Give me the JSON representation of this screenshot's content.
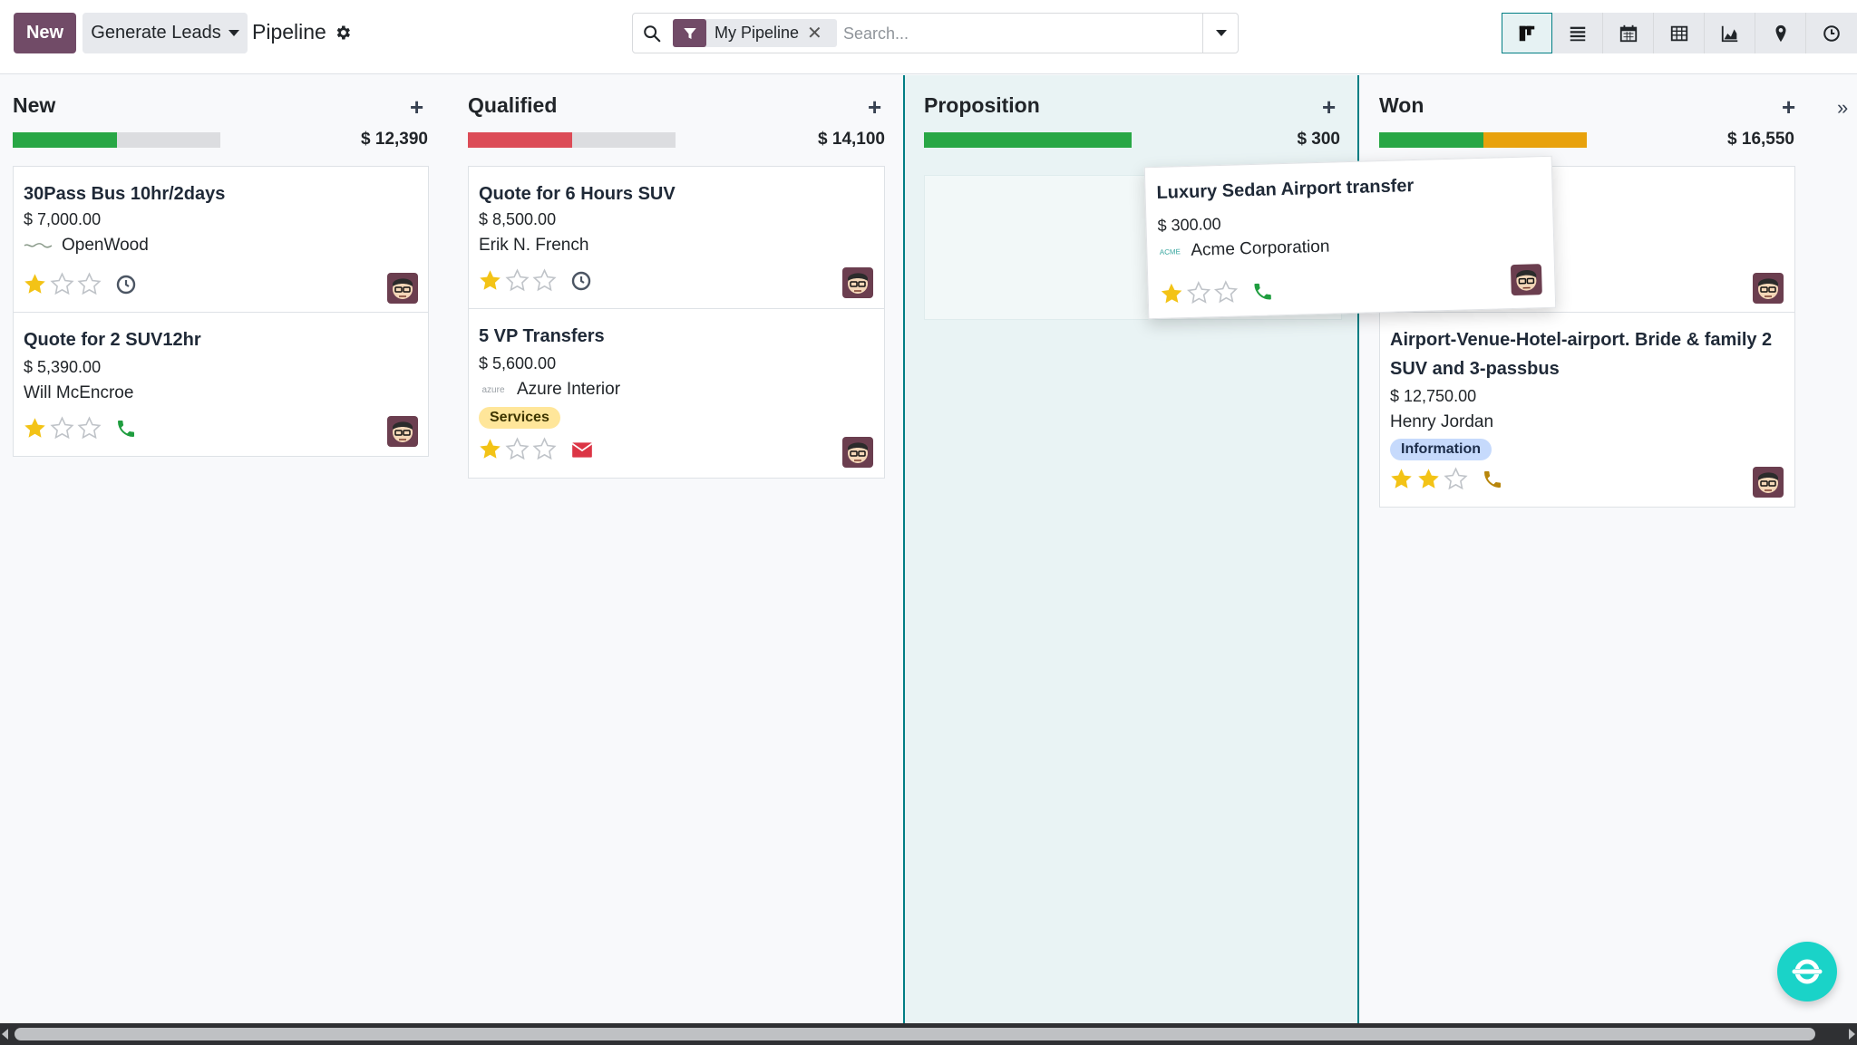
{
  "toolbar": {
    "new_label": "New",
    "generate_label": "Generate Leads",
    "title": "Pipeline",
    "search_facet": "My Pipeline",
    "search_placeholder": "Search...",
    "views": [
      "kanban-view-icon",
      "list-view-icon",
      "calendar-view-icon",
      "pivot-view-icon",
      "graph-view-icon",
      "map-view-icon",
      "activity-view-icon"
    ],
    "active_view": "kanban-view-icon"
  },
  "colors": {
    "primary": "#714b67",
    "accent": "#017e84",
    "success": "#28a745",
    "danger": "#dc4c57",
    "warning": "#e8a20c",
    "star": "#f3c316",
    "tag_services": "#ffe69a",
    "tag_information": "#c6dafc"
  },
  "columns": [
    {
      "title": "New",
      "sum": "$ 12,390",
      "progress": [
        {
          "color": "#28a745",
          "share": 0.5
        },
        {
          "color": "#dcdde0",
          "share": 0.5
        }
      ],
      "cards": [
        {
          "title": "30Pass Bus 10hr/2days",
          "amount": "$ 7,000.00",
          "partner": "OpenWood",
          "partner_logo": "openwood-logo",
          "stars": 1,
          "activity": "clock-icon"
        },
        {
          "title": "Quote for 2 SUV12hr",
          "amount": "$ 5,390.00",
          "partner": "Will McEncroe",
          "stars": 1,
          "activity": "phone-icon"
        }
      ]
    },
    {
      "title": "Qualified",
      "sum": "$ 14,100",
      "progress": [
        {
          "color": "#dc4c57",
          "share": 0.5
        },
        {
          "color": "#dcdde0",
          "share": 0.5
        }
      ],
      "cards": [
        {
          "title": "Quote for 6 Hours SUV",
          "amount": "$ 8,500.00",
          "partner": "Erik N. French",
          "stars": 1,
          "activity": "clock-icon"
        },
        {
          "title": "5 VP Transfers",
          "amount": "$ 5,600.00",
          "partner": "Azure Interior",
          "partner_logo": "azure",
          "tag": "Services",
          "stars": 1,
          "activity": "envelope-icon"
        }
      ]
    },
    {
      "title": "Proposition",
      "sum": "$ 300",
      "progress": [
        {
          "color": "#28a745",
          "share": 1.0
        }
      ],
      "cards": []
    },
    {
      "title": "Won",
      "sum": "$ 16,550",
      "progress": [
        {
          "color": "#28a745",
          "share": 0.5
        },
        {
          "color": "#e8a20c",
          "share": 0.5
        }
      ],
      "cards": [
        {
          "title": "Airport-Venue-Hotel-airport. Bride & family 2 SUV and 3-passbus",
          "amount": "$ 12,750.00",
          "partner": "Henry Jordan",
          "tag": "Information",
          "stars": 2,
          "activity": "phone-icon"
        }
      ]
    }
  ],
  "dragging_card": {
    "title": "Luxury Sedan Airport transfer",
    "amount": "$ 300.00",
    "partner": "Acme Corporation",
    "partner_logo": "ACME",
    "stars": 1,
    "activity": "phone-icon"
  }
}
